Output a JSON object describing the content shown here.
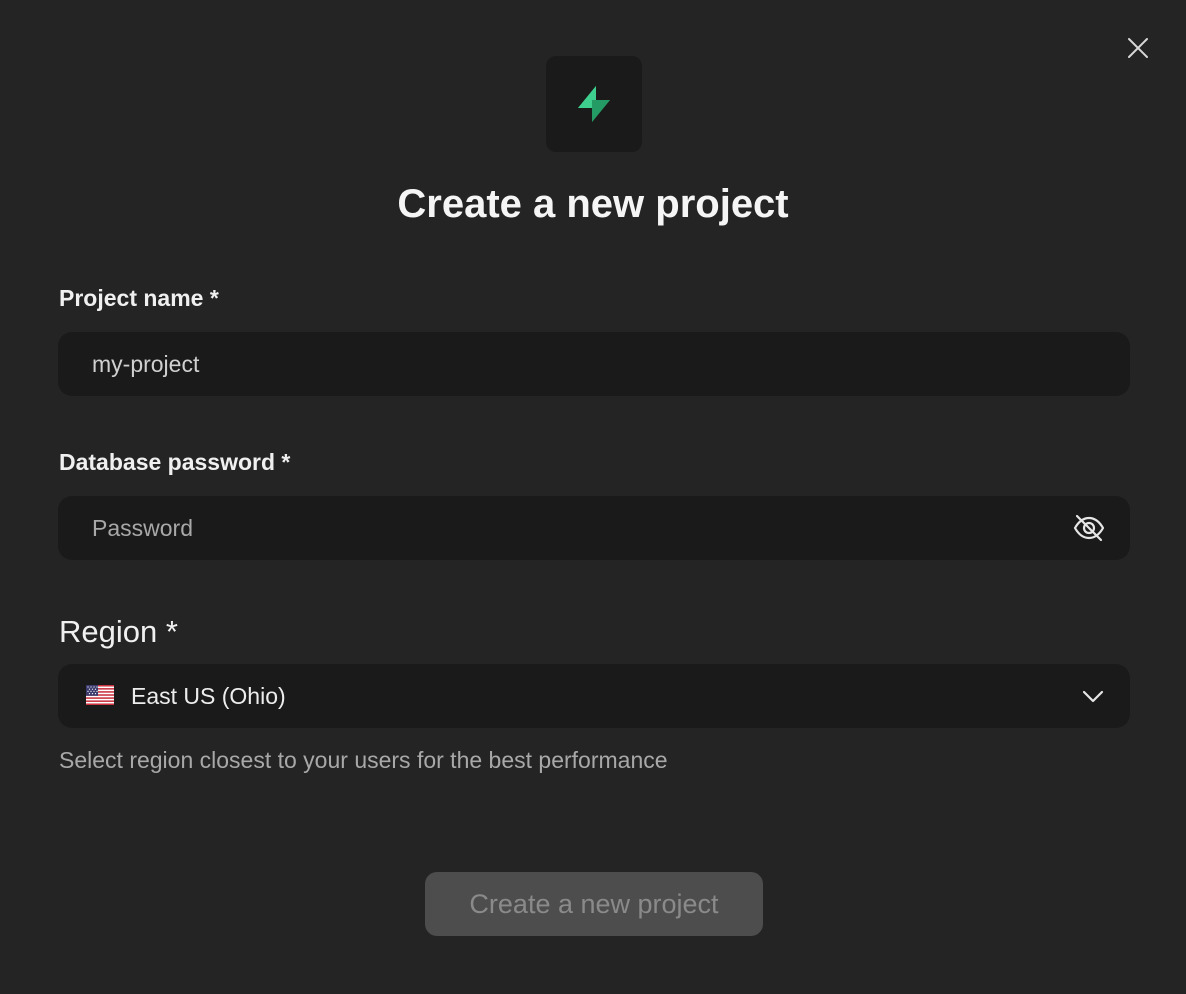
{
  "dialog": {
    "title": "Create a new project",
    "logo_icon": "lightning-bolt-icon",
    "close_icon": "close-icon",
    "brand_color": "#3ecf8e"
  },
  "project_name": {
    "label": "Project name *",
    "value": "my-project",
    "placeholder": ""
  },
  "database_password": {
    "label": "Database password *",
    "value": "",
    "placeholder": "Password",
    "toggle_icon": "eye-off-icon"
  },
  "region": {
    "label": "Region *",
    "selected": "East US (Ohio)",
    "flag_icon": "us-flag-icon",
    "dropdown_icon": "chevron-down-icon",
    "helper": "Select region closest to your users for the best performance"
  },
  "submit": {
    "label": "Create a new project",
    "disabled": true
  }
}
